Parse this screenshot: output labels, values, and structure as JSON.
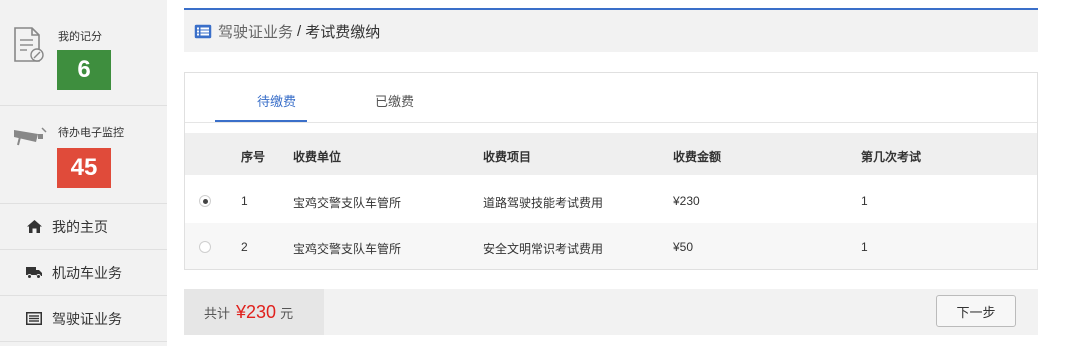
{
  "sidebar": {
    "score_card": {
      "label": "我的记分",
      "count": "6",
      "icon": "document-edit-icon"
    },
    "monitor_card": {
      "label": "待办电子监控",
      "count": "45",
      "icon": "camera-icon"
    },
    "nav": [
      {
        "label": "我的主页",
        "icon": "home-icon"
      },
      {
        "label": "机动车业务",
        "icon": "truck-icon"
      },
      {
        "label": "驾驶证业务",
        "icon": "license-card-icon"
      }
    ]
  },
  "breadcrumb": {
    "icon": "list-icon",
    "parent": "驾驶证业务",
    "separator": "/",
    "current": "考试费缴纳"
  },
  "tabs": [
    {
      "label": "待缴费",
      "active": true
    },
    {
      "label": "已缴费",
      "active": false
    }
  ],
  "table": {
    "headers": [
      "序号",
      "收费单位",
      "收费项目",
      "收费金额",
      "第几次考试"
    ],
    "rows": [
      {
        "selected": true,
        "index": "1",
        "unit": "宝鸡交警支队车管所",
        "item": "道路驾驶技能考试费用",
        "amount": "¥230",
        "times": "1"
      },
      {
        "selected": false,
        "index": "2",
        "unit": "宝鸡交警支队车管所",
        "item": "安全文明常识考试费用",
        "amount": "¥50",
        "times": "1"
      }
    ]
  },
  "footer": {
    "total_label": "共计",
    "total_value": "¥230",
    "total_unit": "元",
    "next_button": "下一步"
  },
  "colors": {
    "accent": "#3a6fc9",
    "score_green": "#3e8e3e",
    "monitor_red": "#e04b3a",
    "total_red": "#e0211d"
  }
}
